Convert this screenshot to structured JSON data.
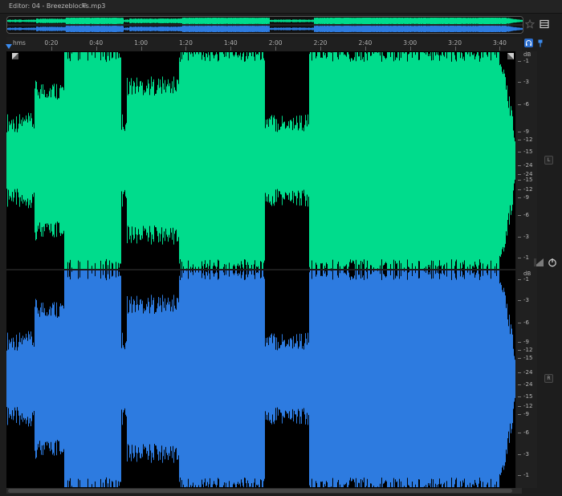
{
  "editor": {
    "tab_title": "Editor: 04 - Breezeblocks.mp3",
    "tab_menu_icon": "hamburger-menu-icon"
  },
  "ruler": {
    "unit_label": "hms",
    "ticks": [
      "0:20",
      "0:40",
      "1:00",
      "1:20",
      "1:40",
      "2:00",
      "2:20",
      "2:40",
      "3:00",
      "3:20",
      "3:40"
    ],
    "tick_seconds": [
      20,
      40,
      60,
      80,
      100,
      120,
      140,
      160,
      180,
      200,
      220
    ],
    "total_seconds": 227
  },
  "channels": [
    {
      "name": "L",
      "color": "#00dc8c"
    },
    {
      "name": "R",
      "color": "#2d7be0"
    }
  ],
  "db_scale": {
    "unit": "dB",
    "upper_labels": [
      "-1",
      "-3",
      "-6",
      "-9",
      "-12",
      "-15",
      "-24",
      "-24",
      "-15",
      "-12",
      "-9",
      "-6",
      "-3",
      "-1"
    ],
    "lower_labels": [
      "-1",
      "-3",
      "-6",
      "-9",
      "-12",
      "-15",
      "-24",
      "-24",
      "-15",
      "-12",
      "-9",
      "-6",
      "-3",
      "-1"
    ]
  },
  "colors": {
    "left_channel": "#00dc8c",
    "right_channel": "#2d7be0",
    "background": "#000000",
    "playhead": "#3b8cf0"
  },
  "toolbar": {
    "icons": [
      "star-icon",
      "list-view-icon",
      "headphones-icon",
      "pin-icon",
      "level-meter-icon",
      "power-icon"
    ]
  }
}
